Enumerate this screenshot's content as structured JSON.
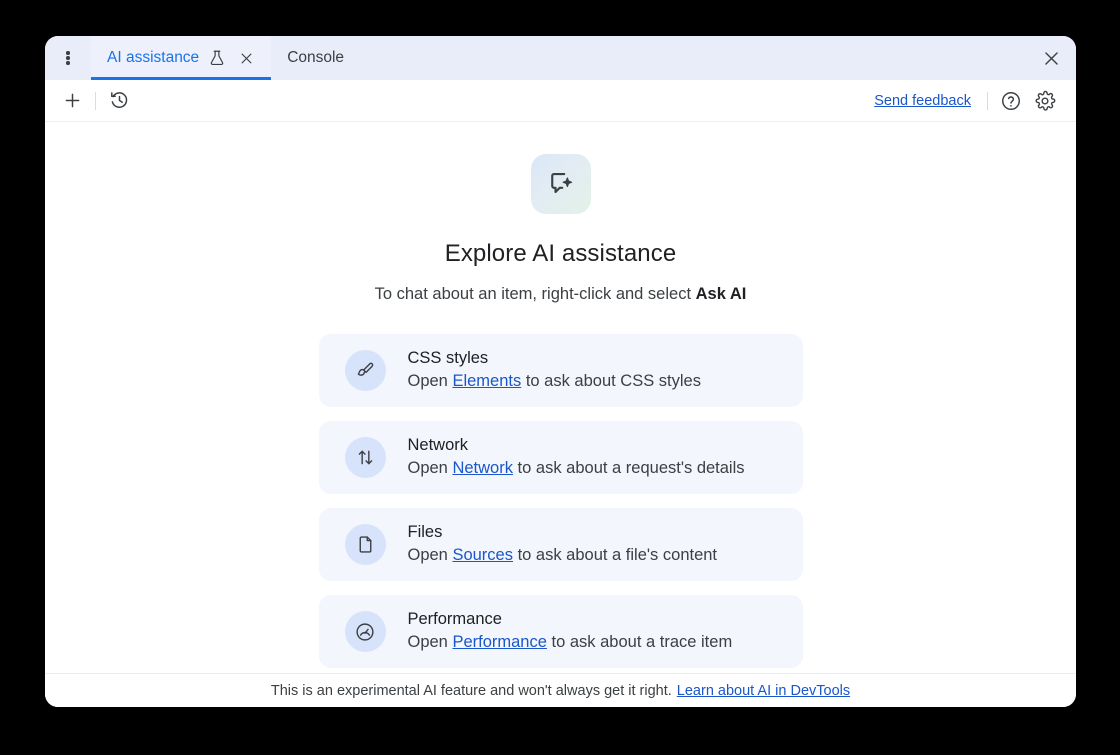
{
  "window": {
    "close_label": "Close DevTools"
  },
  "tabbar": {
    "menu_label": "More options",
    "tabs": [
      {
        "label": "AI assistance",
        "icon": "flask-icon",
        "active": true,
        "closable": true
      },
      {
        "label": "Console",
        "icon": "",
        "active": false,
        "closable": false
      }
    ]
  },
  "toolbar": {
    "new_chat_label": "New chat",
    "history_label": "History",
    "feedback_label": "Send feedback",
    "help_label": "Help",
    "settings_label": "Settings"
  },
  "hero": {
    "icon": "chat-sparkle-icon",
    "title": "Explore AI assistance",
    "subtitle_prefix": "To chat about an item, right-click and select ",
    "subtitle_bold": "Ask AI"
  },
  "cards": [
    {
      "icon": "brush-icon",
      "title": "CSS styles",
      "desc_prefix": "Open ",
      "desc_link": "Elements",
      "desc_suffix": " to ask about CSS styles"
    },
    {
      "icon": "network-arrows-icon",
      "title": "Network",
      "desc_prefix": "Open ",
      "desc_link": "Network",
      "desc_suffix": " to ask about a request's details"
    },
    {
      "icon": "file-icon",
      "title": "Files",
      "desc_prefix": "Open ",
      "desc_link": "Sources",
      "desc_suffix": " to ask about a file's content"
    },
    {
      "icon": "gauge-icon",
      "title": "Performance",
      "desc_prefix": "Open ",
      "desc_link": "Performance",
      "desc_suffix": " to ask about a trace item"
    }
  ],
  "footer": {
    "disclaimer": "This is an experimental AI feature and won't always get it right.",
    "link": "Learn about AI in DevTools"
  },
  "colors": {
    "accent_blue": "#1a73e8",
    "link_blue": "#1a57c9",
    "tabbar_bg": "#e9edf9",
    "card_bg": "#f3f6fc",
    "card_icon_bg": "#d7e3fb"
  }
}
